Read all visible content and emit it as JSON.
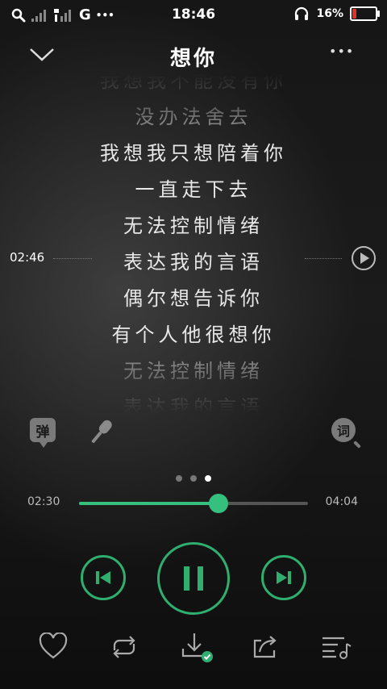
{
  "status": {
    "network": "G",
    "more": "•••",
    "time": "18:46",
    "battery": "16%",
    "battery_level": 0.16,
    "battery_color": "#e0312b"
  },
  "header": {
    "title": "想你",
    "more": "•••"
  },
  "lyrics": [
    {
      "text": "我想我不能没有你",
      "dim": true
    },
    {
      "text": "没办法舍去",
      "dim": true
    },
    {
      "text": "我想我只想陪着你",
      "dim": false
    },
    {
      "text": "一直走下去",
      "dim": false
    },
    {
      "text": "无法控制情绪",
      "dim": false
    },
    {
      "text": "表达我的言语",
      "dim": false
    },
    {
      "text": "偶尔想告诉你",
      "dim": false
    },
    {
      "text": "有个人他很想你",
      "dim": false
    },
    {
      "text": "无法控制情绪",
      "dim": true
    },
    {
      "text": "表达我的言语",
      "dim": true
    }
  ],
  "seek_time": "02:46",
  "actions": {
    "danmaku_label": "弹",
    "lyrics_label": "词"
  },
  "pager": {
    "count": 3,
    "active": 2
  },
  "progress": {
    "current": "02:30",
    "total": "04:04",
    "fraction": 0.61
  },
  "accent": "#35c07e"
}
